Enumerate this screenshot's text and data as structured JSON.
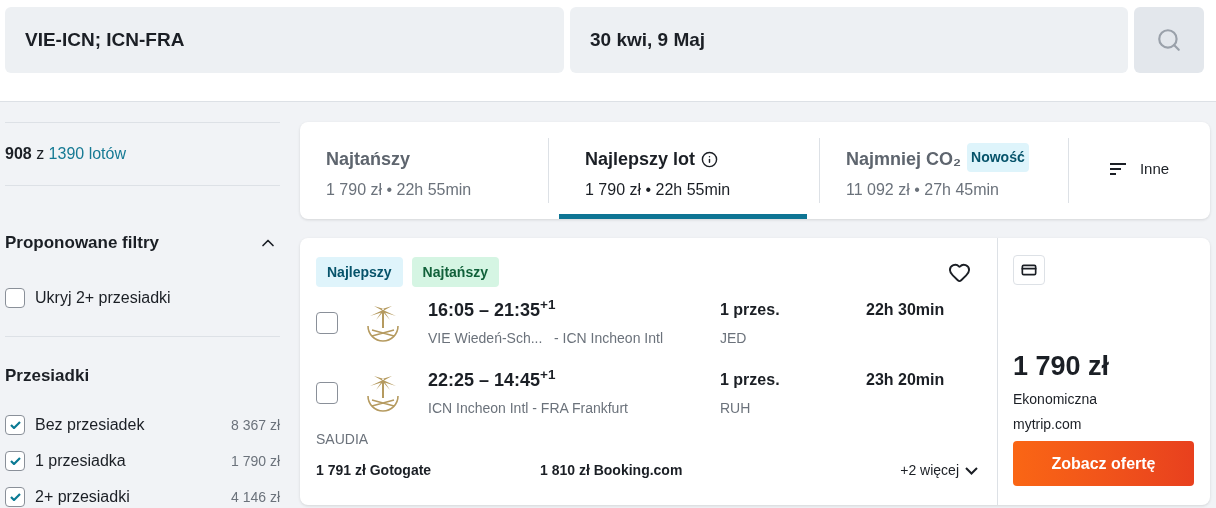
{
  "search": {
    "route": "VIE-ICN; ICN-FRA",
    "dates": "30 kwi, 9 Maj"
  },
  "summary": {
    "shown": "908",
    "of": "z",
    "total": "1390 lotów"
  },
  "suggested_filters": {
    "title": "Proponowane filtry",
    "expanded": true,
    "items": [
      {
        "label": "Ukryj 2+ przesiadki",
        "checked": false
      }
    ]
  },
  "stops_filter": {
    "title": "Przesiadki",
    "items": [
      {
        "label": "Bez przesiadek",
        "price": "8 367 zł",
        "checked": true
      },
      {
        "label": "1 przesiadka",
        "price": "1 790 zł",
        "checked": true
      },
      {
        "label": "2+ przesiadki",
        "price": "4 146 zł",
        "checked": true
      }
    ]
  },
  "sort_tabs": [
    {
      "label": "Najtańszy",
      "detail": "1 790 zł • 22h 55min",
      "selected": false,
      "has_info": false
    },
    {
      "label": "Najlepszy lot",
      "detail": "1 790 zł • 22h 55min",
      "selected": true,
      "has_info": true
    },
    {
      "label": "Najmniej CO₂",
      "detail": "11 092 zł • 27h 45min",
      "selected": false,
      "has_info": false,
      "badge": "Nowość"
    }
  ],
  "more_sort": "Inne",
  "result": {
    "tags": [
      {
        "label": "Najlepszy",
        "kind": "best"
      },
      {
        "label": "Najtańszy",
        "kind": "cheapest"
      }
    ],
    "favorite": false,
    "legs": [
      {
        "checked": false,
        "times": "16:05 – 21:35$^{+1}$",
        "route": "VIE Wiedeń-Sch...   - ICN Incheon Intl",
        "stops": "1 przes.",
        "via": "JED",
        "duration": "22h 30min"
      },
      {
        "checked": false,
        "times": "22:25 – 14:45$^{+1}$",
        "route": "ICN Incheon Intl - FRA Frankfurt",
        "stops": "1 przes.",
        "via": "RUH",
        "duration": "23h 20min"
      }
    ],
    "airline": "SAUDIA",
    "other_offers": [
      "1 791 zł Gotogate",
      "1 810 zł Booking.com"
    ],
    "more_offers": "+2 więcej",
    "price": "1 790 zł",
    "cabin": "Ekonomiczna",
    "provider": "mytrip.com",
    "cta": "Zobacz ofertę"
  }
}
